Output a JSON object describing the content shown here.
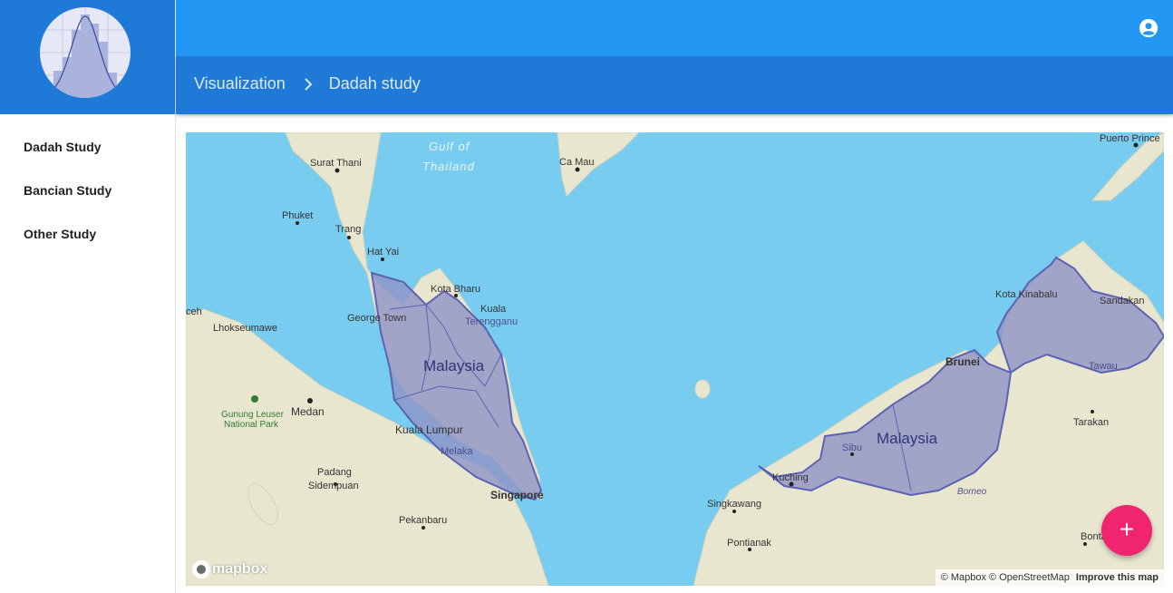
{
  "sidebar": {
    "items": [
      {
        "label": "Dadah Study"
      },
      {
        "label": "Bancian Study"
      },
      {
        "label": "Other Study"
      }
    ]
  },
  "breadcrumb": {
    "items": [
      "Visualization",
      "Dadah study"
    ]
  },
  "map": {
    "labels": {
      "gulf": "Gulf of",
      "gulf2": "Thailand",
      "surat_thani": "Surat Thani",
      "ca_mau": "Ca Mau",
      "puerto_princesa": "Puerto Prince",
      "phuket": "Phuket",
      "trang": "Trang",
      "hat_yai": "Hat Yai",
      "kota_bharu": "Kota Bharu",
      "kuala_t": "Kuala",
      "terengganu": "Terengganu",
      "george_town": "George Town",
      "malaysia_west": "Malaysia",
      "kuala_lumpur": "Kuala Lumpur",
      "melaka": "Melaka",
      "singapore": "Singapore",
      "lhokseumawe": "Lhokseumawe",
      "aceh": "ceh",
      "medan": "Medan",
      "gunung_leuser": "Gunung Leuser",
      "national_park": "National Park",
      "padang_sidempuan_1": "Padang",
      "padang_sidempuan_2": "Sidempuan",
      "pekanbaru": "Pekanbaru",
      "kota_kinabalu": "Kota Kinabalu",
      "sandakan": "Sandakan",
      "brunei": "Brunei",
      "tawau": "Tawau",
      "tarakan": "Tarakan",
      "malaysia_east": "Malaysia",
      "sibu": "Sibu",
      "kuching": "Kuching",
      "borneo": "Borneo",
      "singkawang": "Singkawang",
      "pontianak": "Pontianak",
      "bontang": "Bontang"
    },
    "attribution": "© Mapbox © OpenStreetMap",
    "improve": "Improve this map",
    "logo_text": "mapbox",
    "colors": {
      "water": "#78ccef",
      "land": "#e9e6cf",
      "region": "#8f93c4",
      "region_stroke": "#5b63b4"
    }
  },
  "fab": {
    "label": "+"
  }
}
